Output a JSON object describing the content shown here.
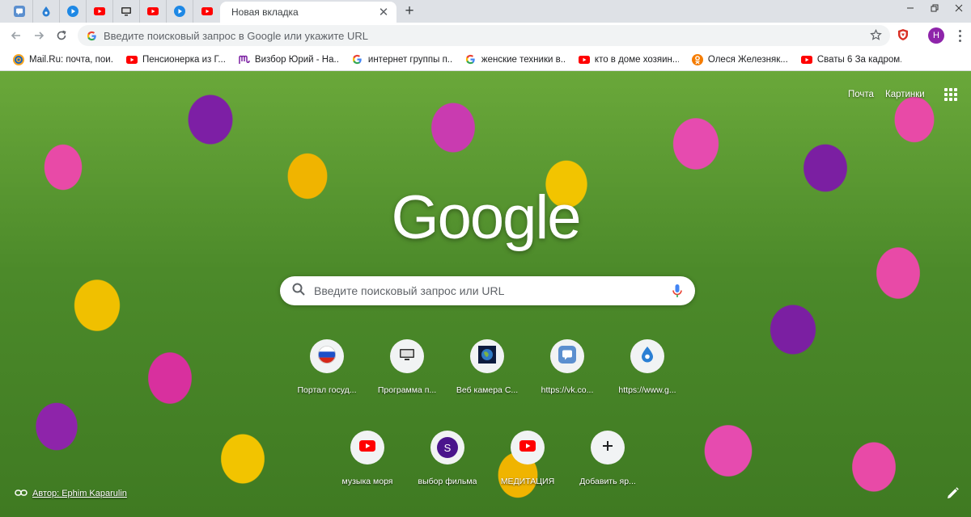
{
  "tabs": {
    "pinned": [
      {
        "icon": "vk-chat-icon"
      },
      {
        "icon": "drop-icon"
      },
      {
        "icon": "play-icon"
      },
      {
        "icon": "youtube-icon"
      },
      {
        "icon": "monitor-icon"
      },
      {
        "icon": "youtube-icon"
      },
      {
        "icon": "play-icon"
      },
      {
        "icon": "youtube-icon"
      }
    ],
    "active_title": "Новая вкладка"
  },
  "toolbar": {
    "omnibox_placeholder": "Введите поисковый запрос в Google или укажите URL",
    "profile_initial": "Н"
  },
  "bookmarks": [
    {
      "icon": "mailru-icon",
      "label": "Mail.Ru: почта, пои..."
    },
    {
      "icon": "youtube-icon",
      "label": "Пенсионерка из Г..."
    },
    {
      "icon": "my-icon",
      "label": "Визбор Юрий - На..."
    },
    {
      "icon": "google-icon",
      "label": "интернет группы п..."
    },
    {
      "icon": "google-icon",
      "label": "женские техники в..."
    },
    {
      "icon": "youtube-icon",
      "label": "кто в доме хозяин..."
    },
    {
      "icon": "ok-icon",
      "label": "Олеся Железняк..."
    },
    {
      "icon": "youtube-icon",
      "label": "Сваты 6 За кадром..."
    }
  ],
  "ntp": {
    "links": {
      "mail": "Почта",
      "images": "Картинки"
    },
    "logo_text": "Google",
    "search_placeholder": "Введите поисковый запрос или URL",
    "shortcuts_row1": [
      {
        "icon": "russia-flag-icon",
        "label": "Портал госуд..."
      },
      {
        "icon": "monitor-icon",
        "label": "Программа п..."
      },
      {
        "icon": "earth-icon",
        "label": "Веб камера С..."
      },
      {
        "icon": "vk-chat-icon",
        "label": "https://vk.co..."
      },
      {
        "icon": "drop-icon",
        "label": "https://www.g..."
      }
    ],
    "shortcuts_row2": [
      {
        "icon": "youtube-icon",
        "label": "музыка моря"
      },
      {
        "icon": "letter-s-icon",
        "label": "выбор фильма",
        "letter": "S"
      },
      {
        "icon": "youtube-icon",
        "label": "МЕДИТАЦИЯ"
      },
      {
        "icon": "plus-icon",
        "label": "Добавить яр..."
      }
    ],
    "attribution": "Автор: Ephim Kaparulin"
  },
  "colors": {
    "youtube_red": "#ff0000",
    "accent_blue": "#1a73e8",
    "profile_purple": "#8e24aa"
  }
}
